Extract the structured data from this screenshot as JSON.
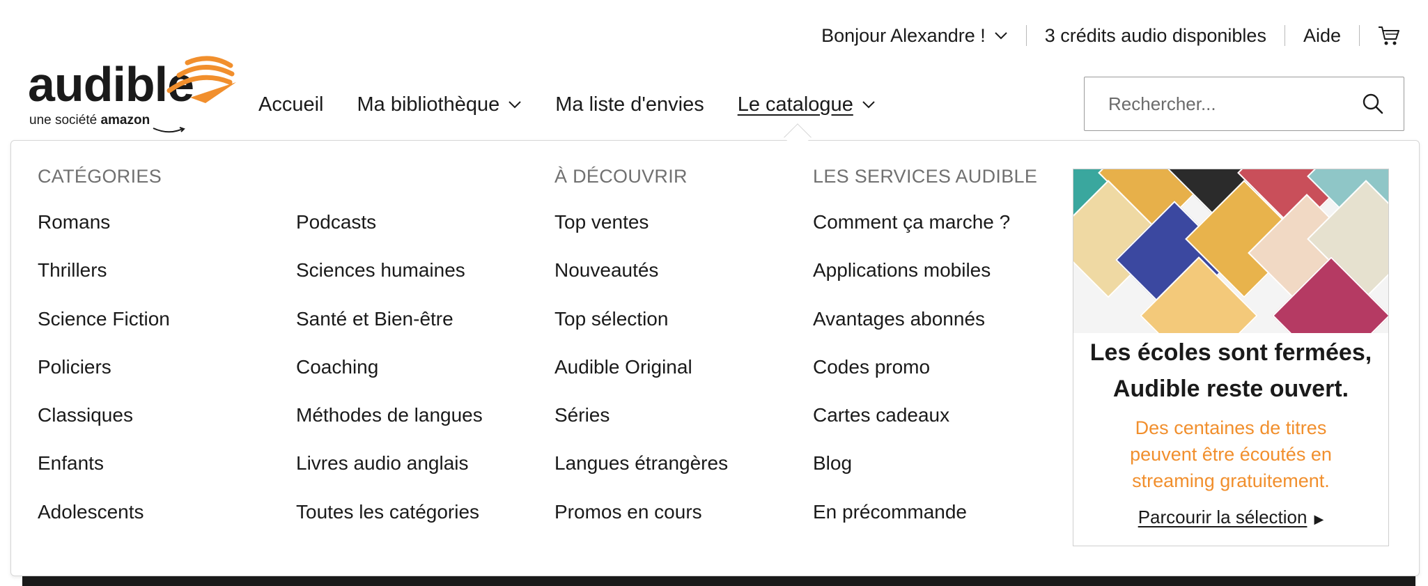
{
  "topbar": {
    "greeting": "Bonjour Alexandre !",
    "credits": "3 crédits audio disponibles",
    "help": "Aide",
    "cart_icon": "cart-icon"
  },
  "logo": {
    "wordmark": "audible",
    "tagline_prefix": "une société",
    "tagline_brand": "amazon"
  },
  "nav": {
    "home": "Accueil",
    "library": "Ma bibliothèque",
    "wishlist": "Ma liste d'envies",
    "catalog": "Le catalogue"
  },
  "search": {
    "placeholder": "Rechercher...",
    "icon": "search-icon"
  },
  "menu": {
    "categories_title": "CATÉGORIES",
    "categories_col1": [
      "Romans",
      "Thrillers",
      "Science Fiction",
      "Policiers",
      "Classiques",
      "Enfants",
      "Adolescents"
    ],
    "categories_col2": [
      "Podcasts",
      "Sciences humaines",
      "Santé et Bien-être",
      "Coaching",
      "Méthodes de langues",
      "Livres audio anglais",
      "Toutes les catégories"
    ],
    "discover_title": "À DÉCOUVRIR",
    "discover": [
      "Top ventes",
      "Nouveautés",
      "Top sélection",
      "Audible Original",
      "Séries",
      "Langues étrangères",
      "Promos en cours"
    ],
    "services_title": "LES SERVICES AUDIBLE",
    "services": [
      "Comment ça marche ?",
      "Applications mobiles",
      "Avantages abonnés",
      "Codes promo",
      "Cartes cadeaux",
      "Blog",
      "En précommande"
    ]
  },
  "promo": {
    "headline_line1": "Les écoles sont fermées,",
    "headline_line2": "Audible reste ouvert.",
    "sub_line1": "Des centaines de titres",
    "sub_line2": "peuvent être écoutés en",
    "sub_line3": "streaming gratuitement.",
    "cta": "Parcourir la sélection"
  },
  "colors": {
    "accent": "#f18f2d",
    "text": "#1a1a1a",
    "heading": "#707070"
  }
}
